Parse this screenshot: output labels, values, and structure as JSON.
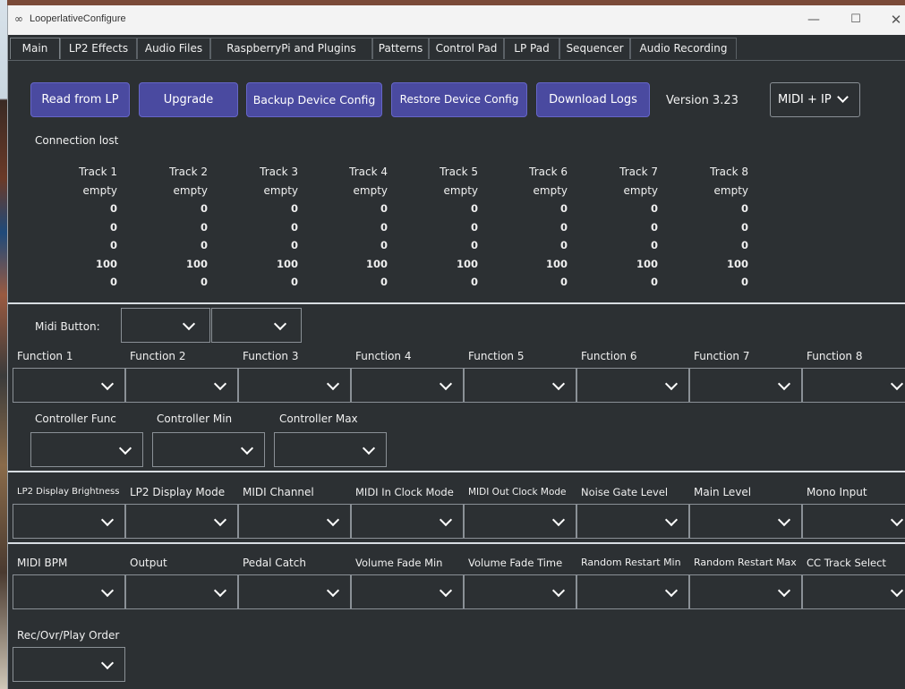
{
  "window": {
    "title": "LooperlativeConfigure",
    "app_icon": "link-icon"
  },
  "tabs": [
    {
      "label": "Main",
      "active": true
    },
    {
      "label": "LP2 Effects"
    },
    {
      "label": "Audio Files"
    },
    {
      "label": "RaspberryPi and Plugins"
    },
    {
      "label": "Patterns"
    },
    {
      "label": "Control Pad"
    },
    {
      "label": "LP Pad"
    },
    {
      "label": "Sequencer"
    },
    {
      "label": "Audio Recording"
    }
  ],
  "toolbar": {
    "read_label": "Read from LP",
    "upgrade_label": "Upgrade",
    "backup_label": "Backup Device Config",
    "restore_label": "Restore Device Config",
    "download_label": "Download Logs",
    "version": "Version 3.23",
    "mode_value": "MIDI + IP"
  },
  "status": "Connection lost",
  "tracks": [
    {
      "name": "Track 1",
      "state": "empty",
      "v1": "0",
      "v2": "0",
      "v3": "0",
      "v4": "100",
      "v5": "0"
    },
    {
      "name": "Track 2",
      "state": "empty",
      "v1": "0",
      "v2": "0",
      "v3": "0",
      "v4": "100",
      "v5": "0"
    },
    {
      "name": "Track 3",
      "state": "empty",
      "v1": "0",
      "v2": "0",
      "v3": "0",
      "v4": "100",
      "v5": "0"
    },
    {
      "name": "Track 4",
      "state": "empty",
      "v1": "0",
      "v2": "0",
      "v3": "0",
      "v4": "100",
      "v5": "0"
    },
    {
      "name": "Track 5",
      "state": "empty",
      "v1": "0",
      "v2": "0",
      "v3": "0",
      "v4": "100",
      "v5": "0"
    },
    {
      "name": "Track 6",
      "state": "empty",
      "v1": "0",
      "v2": "0",
      "v3": "0",
      "v4": "100",
      "v5": "0"
    },
    {
      "name": "Track 7",
      "state": "empty",
      "v1": "0",
      "v2": "0",
      "v3": "0",
      "v4": "100",
      "v5": "0"
    },
    {
      "name": "Track 8",
      "state": "empty",
      "v1": "0",
      "v2": "0",
      "v3": "0",
      "v4": "100",
      "v5": "0"
    }
  ],
  "midi_button_label": "Midi Button:",
  "functions": [
    "Function 1",
    "Function 2",
    "Function 3",
    "Function 4",
    "Function 5",
    "Function 6",
    "Function 7",
    "Function 8"
  ],
  "controller": {
    "func": "Controller Func",
    "min": "Controller Min",
    "max": "Controller Max"
  },
  "settings_row1": [
    "LP2 Display Brightness",
    "LP2 Display Mode",
    "MIDI Channel",
    "MIDI In Clock Mode",
    "MIDI Out Clock Mode",
    "Noise Gate Level",
    "Main Level",
    "Mono Input"
  ],
  "settings_row2": [
    "MIDI BPM",
    "Output",
    "Pedal Catch",
    "Volume Fade Min",
    "Volume Fade Time",
    "Random Restart Min",
    "Random Restart Max",
    "CC Track Select"
  ],
  "rec_order_label": "Rec/Ovr/Play Order"
}
